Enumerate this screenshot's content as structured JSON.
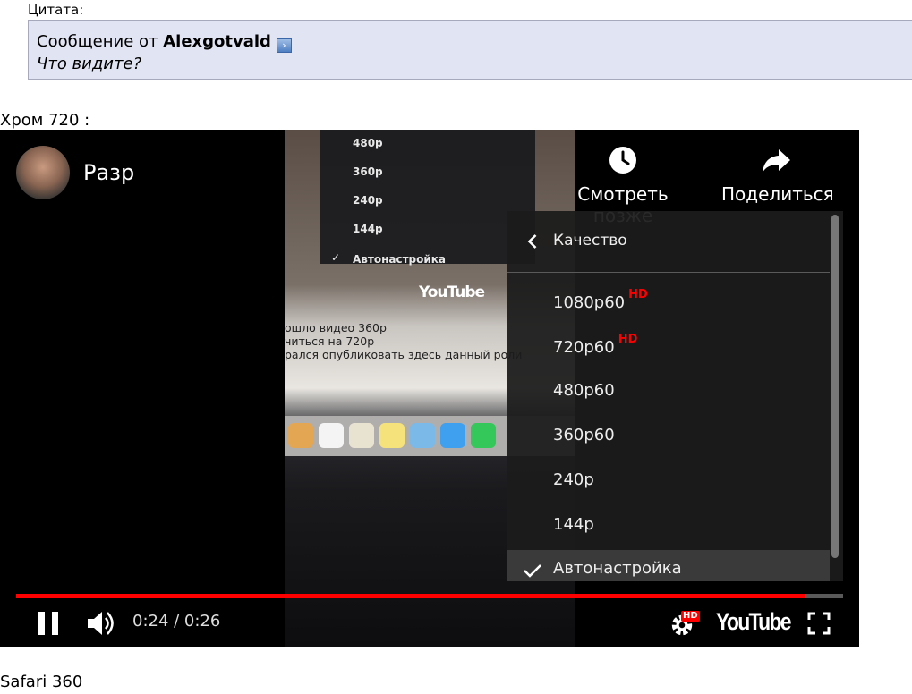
{
  "quote": {
    "label": "Цитата:",
    "prefix": "Сообщение от ",
    "author": "Alexgotvald",
    "text": "Что видите?"
  },
  "labels": {
    "chrome": "Хром 720 :",
    "safari": "Safari 360"
  },
  "player": {
    "title": "Разр",
    "watch_later": "Смотреть позже",
    "share": "Поделиться",
    "time": "0:24 / 0:26",
    "progress": 0.955,
    "hd_badge": "HD",
    "logo": "YouTube",
    "icons": [
      "clock-icon",
      "share-arrow-icon",
      "chevron-left-icon",
      "checkmark-icon",
      "pause-icon",
      "volume-icon",
      "settings-gear-icon",
      "fullscreen-icon"
    ],
    "accent": "#ff0000",
    "quality_menu": {
      "title": "Качество",
      "items": [
        {
          "label": "1080p60",
          "badge": "HD"
        },
        {
          "label": "720p60",
          "badge": "HD"
        },
        {
          "label": "480p60",
          "badge": ""
        },
        {
          "label": "360p60",
          "badge": ""
        },
        {
          "label": "240p",
          "badge": ""
        },
        {
          "label": "144p",
          "badge": ""
        },
        {
          "label": "Автонастройка",
          "badge": ""
        }
      ]
    },
    "frame": {
      "menu_items": [
        "480p",
        "360p",
        "240p",
        "144p",
        "Автонастройка"
      ],
      "logo": "YouTube",
      "lines": [
        "ошло видео 360р",
        "читься на 720р",
        "рался опубликовать здесь данный роли"
      ]
    }
  }
}
